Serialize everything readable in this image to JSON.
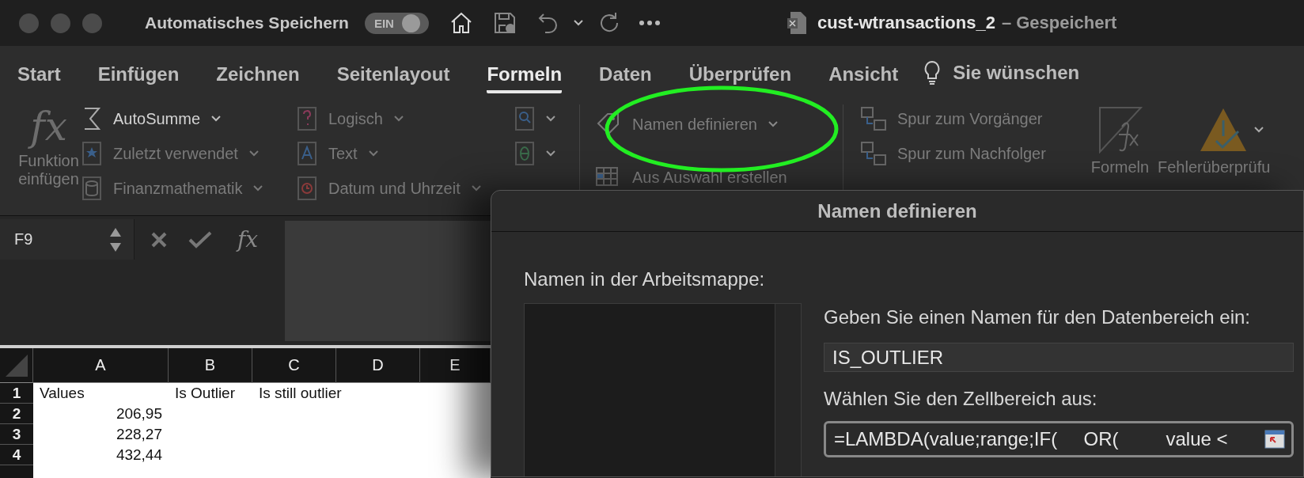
{
  "title_bar": {
    "autosave_label": "Automatisches Speichern",
    "autosave_toggle": {
      "label": "EIN",
      "on": true
    },
    "document_name": "cust-wtransactions_2",
    "save_status": "– Gespeichert"
  },
  "ribbon_tabs": [
    {
      "label": "Start",
      "selected": false
    },
    {
      "label": "Einfügen",
      "selected": false
    },
    {
      "label": "Zeichnen",
      "selected": false
    },
    {
      "label": "Seitenlayout",
      "selected": false
    },
    {
      "label": "Formeln",
      "selected": true
    },
    {
      "label": "Daten",
      "selected": false
    },
    {
      "label": "Überprüfen",
      "selected": false
    },
    {
      "label": "Ansicht",
      "selected": false
    }
  ],
  "tell_me": "Sie wünschen",
  "ribbon": {
    "insert_function": {
      "icon": "fx",
      "label": "Funktion einfügen"
    },
    "function_library": [
      {
        "label": "AutoSumme",
        "disabled": false
      },
      {
        "label": "Zuletzt verwendet",
        "disabled": true
      },
      {
        "label": "Finanzmathematik",
        "disabled": true
      },
      {
        "label": "Logisch",
        "disabled": true
      },
      {
        "label": "Text",
        "disabled": true
      },
      {
        "label": "Datum und Uhrzeit",
        "disabled": true
      }
    ],
    "defined_names": [
      "Namen definieren",
      "Aus Auswahl erstellen"
    ],
    "formula_auditing": [
      "Spur zum Vorgänger",
      "Spur zum Nachfolger"
    ],
    "show_formulas": "Formeln",
    "error_checking": "Fehlerüberprüfu"
  },
  "formula_bar": {
    "name_box": "F9",
    "function_icon": "fx"
  },
  "sheet": {
    "columns": [
      "A",
      "B",
      "C",
      "D",
      "E"
    ],
    "rows": [
      {
        "number": "1",
        "kind": "text",
        "cells": [
          "Values",
          "Is Outlier",
          "Is still outlier"
        ]
      },
      {
        "number": "2",
        "kind": "number",
        "cells": [
          "206,95"
        ]
      },
      {
        "number": "3",
        "kind": "number",
        "cells": [
          "228,27"
        ]
      },
      {
        "number": "4",
        "kind": "number",
        "cells": [
          "432,44"
        ]
      }
    ]
  },
  "dialog": {
    "title": "Namen definieren",
    "names_label": "Namen in der Arbeitsmappe:",
    "name_prompt": "Geben Sie einen Namen für den Datenbereich ein:",
    "name_value": "IS_OUTLIER",
    "range_prompt": "Wählen Sie den Zellbereich aus:",
    "range_value": "=LAMBDA(value;range;IF(     OR(         value <"
  }
}
